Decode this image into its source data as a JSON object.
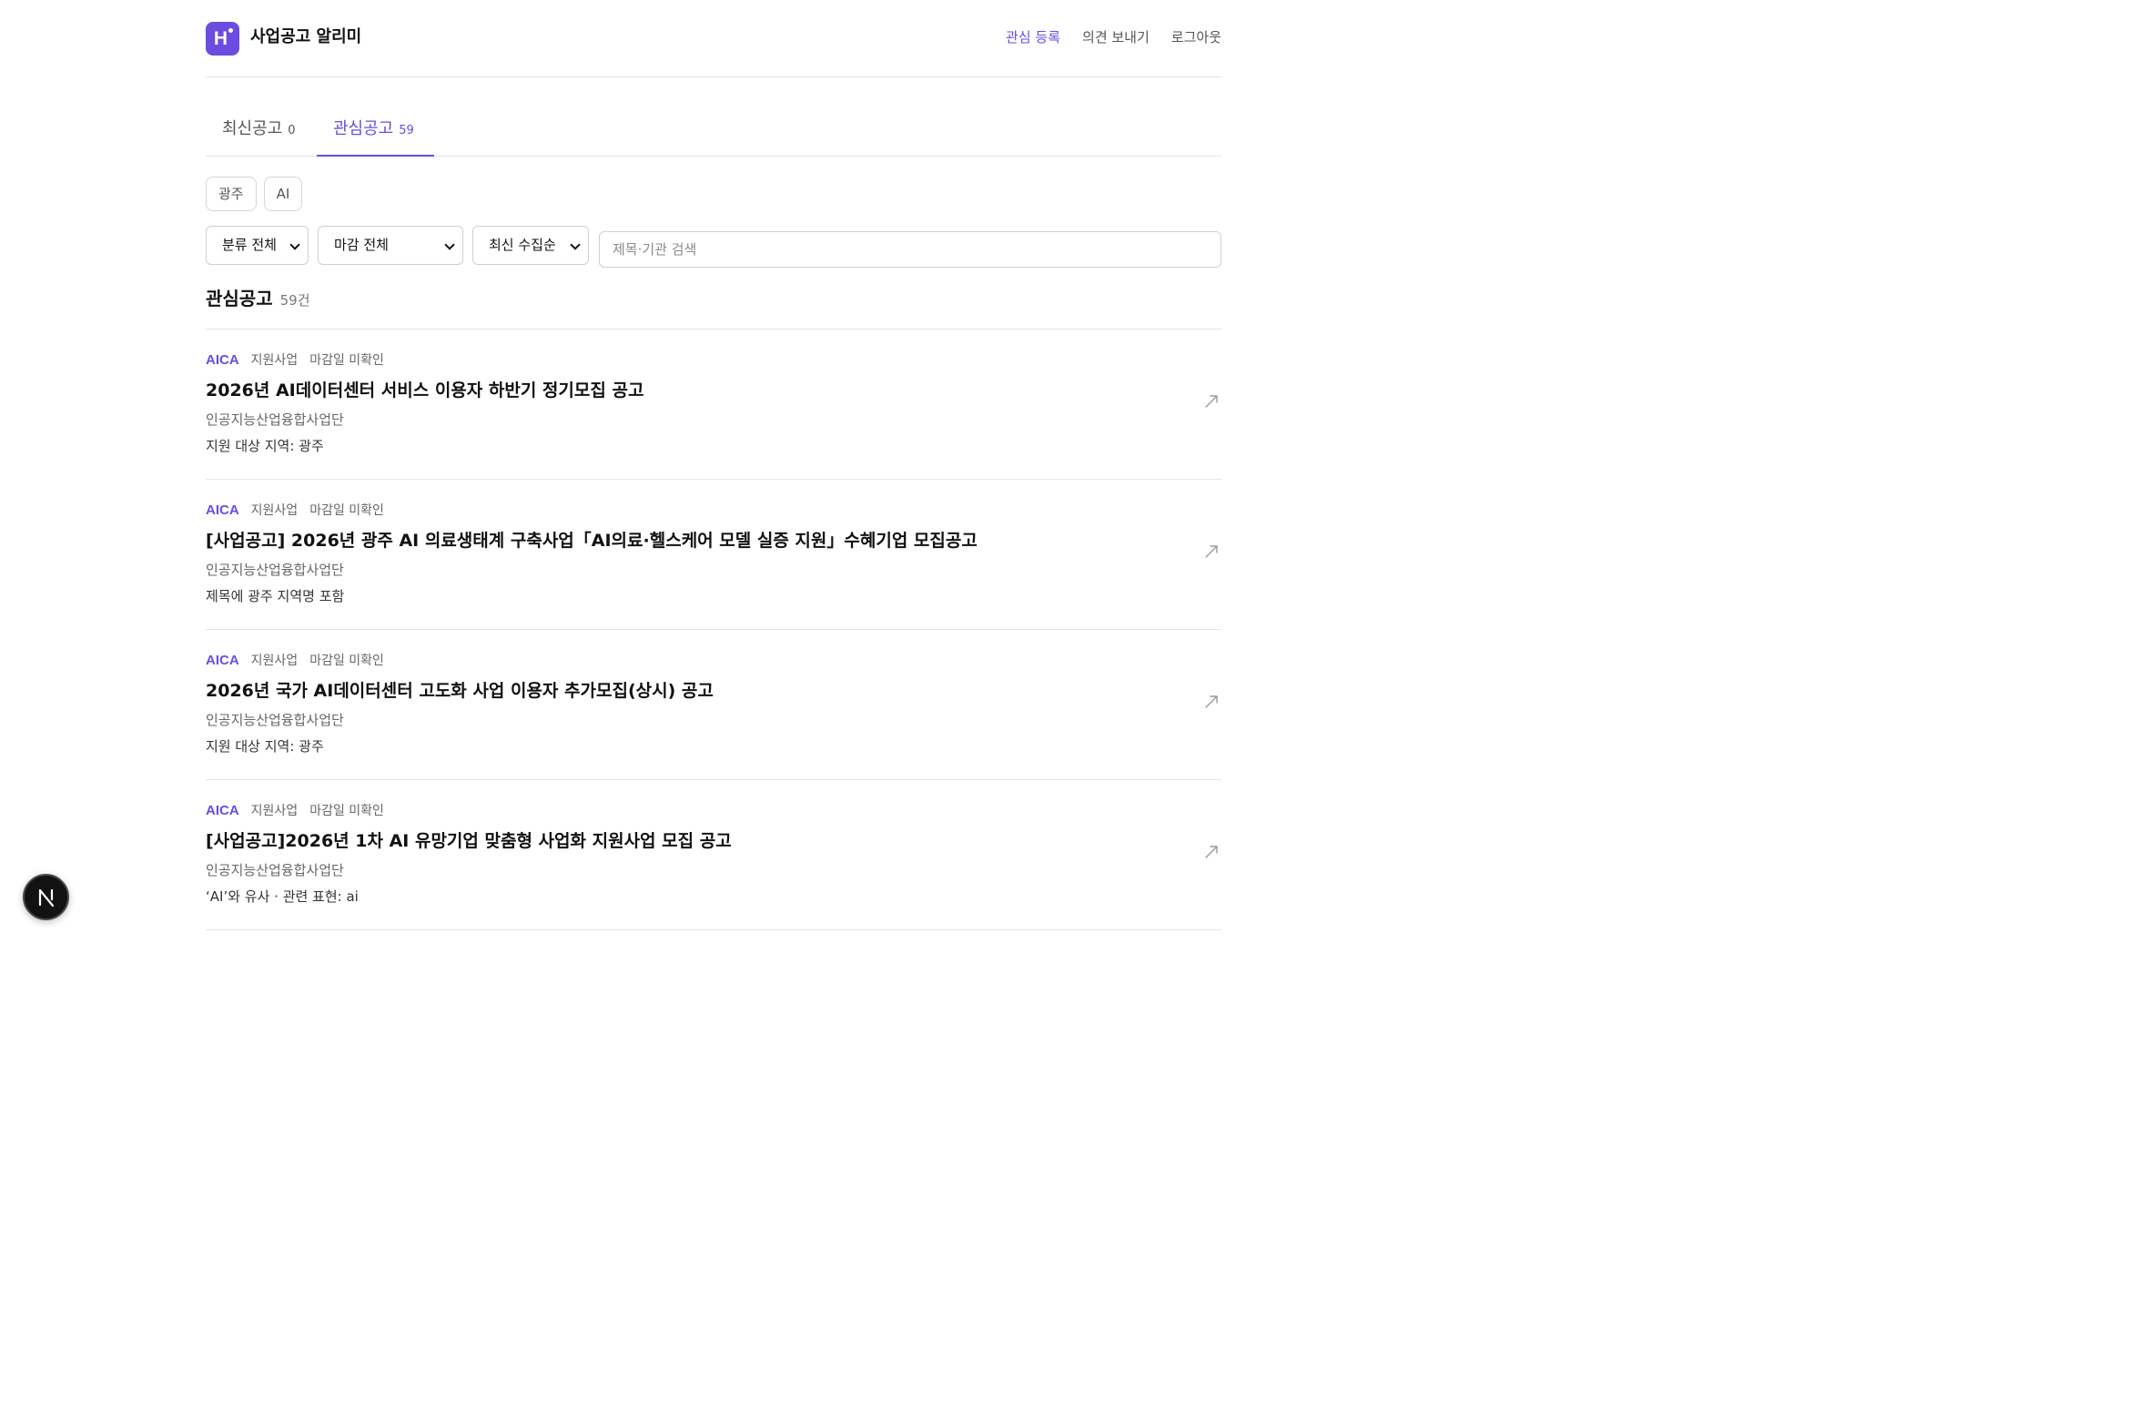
{
  "header": {
    "logo_text": "H",
    "title": "사업공고 알리미",
    "nav": [
      "관심 등록",
      "의견 보내기",
      "로그아웃"
    ]
  },
  "tabs": [
    {
      "label": "최신공고",
      "count": "0"
    },
    {
      "label": "관심공고",
      "count": "59"
    }
  ],
  "keywords": [
    "광주",
    "AI"
  ],
  "filters": {
    "category": "분류 전체",
    "deadline": "마감 전체",
    "sort": "최신 수집순",
    "search_placeholder": "제목·기관 검색"
  },
  "section": {
    "title": "관심공고",
    "count": "59건"
  },
  "items": [
    {
      "org": "AICA",
      "category": "지원사업",
      "deadline": "마감일 미확인",
      "title": "2026년 AI데이터센터 서비스 이용자 하반기 정기모집 공고",
      "agency": "인공지능산업융합사업단",
      "match": "지원 대상 지역: 광주"
    },
    {
      "org": "AICA",
      "category": "지원사업",
      "deadline": "마감일 미확인",
      "title": "[사업공고] 2026년 광주 AI 의료생태계 구축사업「AI의료·헬스케어 모델 실증 지원」수혜기업 모집공고",
      "agency": "인공지능산업융합사업단",
      "match": "제목에 광주 지역명 포함"
    },
    {
      "org": "AICA",
      "category": "지원사업",
      "deadline": "마감일 미확인",
      "title": "2026년 국가 AI데이터센터 고도화 사업 이용자 추가모집(상시) 공고",
      "agency": "인공지능산업융합사업단",
      "match": "지원 대상 지역: 광주"
    },
    {
      "org": "AICA",
      "category": "지원사업",
      "deadline": "마감일 미확인",
      "title": "[사업공고]2026년 1차 AI 유망기업 맞춤형 사업화 지원사업 모집 공고",
      "agency": "인공지능산업융합사업단",
      "match": "‘AI’와 유사 · 관련 표현: ai"
    }
  ],
  "colors": {
    "accent": "#6a4de0",
    "text": "#111111",
    "muted": "#666666",
    "border": "#e5e5e5"
  }
}
